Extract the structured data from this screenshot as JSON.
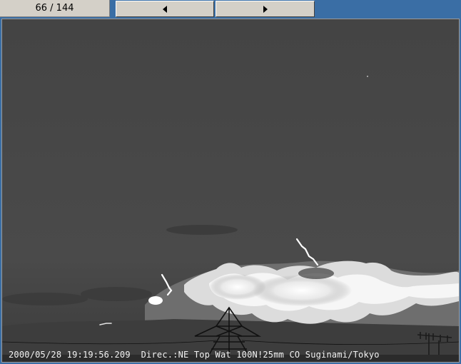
{
  "toolbar": {
    "counter": "66 / 144",
    "prev_icon": "triangle-left-icon",
    "next_icon": "triangle-right-icon"
  },
  "frame": {
    "caption": "2000/05/28 19:19:56.209  Direc.:NE Top Wat 100N!25mm CO Suginami/Tokyo"
  },
  "colors": {
    "desktop": "#3a6ea5",
    "button_face": "#d4d0c8",
    "sky": "#454545"
  }
}
